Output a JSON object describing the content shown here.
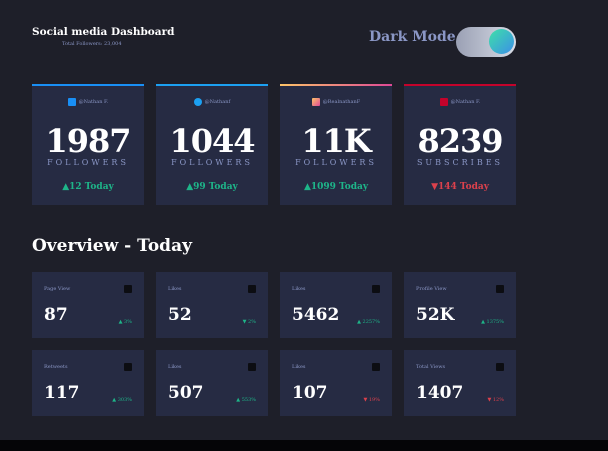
{
  "header": {
    "title": "Social media Dashboard",
    "subtitle": "Total Followers: 23,004",
    "dark_mode_label": "Dark Mode"
  },
  "colors": {
    "facebook": "#198ff5",
    "twitter": "#1ca0f2",
    "instagram_start": "#fdc468",
    "instagram_end": "#df4996",
    "youtube": "#c4032b",
    "up": "#1eb589",
    "down": "#dc414c"
  },
  "cards": [
    {
      "handle": "@Nathan F.",
      "icon": "facebook-icon",
      "value": "1987",
      "label": "FOLLOWERS",
      "change": "▲12 Today",
      "dir": "up"
    },
    {
      "handle": "@Nathanf",
      "icon": "twitter-icon",
      "value": "1044",
      "label": "FOLLOWERS",
      "change": "▲99 Today",
      "dir": "up"
    },
    {
      "handle": "@RealnathanF",
      "icon": "instagram-icon",
      "value": "11K",
      "label": "FOLLOWERS",
      "change": "▲1099 Today",
      "dir": "up"
    },
    {
      "handle": "@Nathan F.",
      "icon": "youtube-icon",
      "value": "8239",
      "label": "SUBSCRIBES",
      "change": "▼144 Today",
      "dir": "down"
    }
  ],
  "overview": {
    "title": "Overview - Today",
    "items": [
      {
        "label": "Page View",
        "icon": "facebook-icon",
        "value": "87",
        "pct": "▲ 3%",
        "dir": "up"
      },
      {
        "label": "Likes",
        "icon": "facebook-icon",
        "value": "52",
        "pct": "▼ 2%",
        "dir": "up"
      },
      {
        "label": "Likes",
        "icon": "instagram-icon",
        "value": "5462",
        "pct": "▲ 2257%",
        "dir": "up"
      },
      {
        "label": "Profile View",
        "icon": "instagram-icon",
        "value": "52K",
        "pct": "▲ 1375%",
        "dir": "up"
      },
      {
        "label": "Retweets",
        "icon": "twitter-icon",
        "value": "117",
        "pct": "▲ 303%",
        "dir": "up"
      },
      {
        "label": "Likes",
        "icon": "twitter-icon",
        "value": "507",
        "pct": "▲ 553%",
        "dir": "up"
      },
      {
        "label": "Likes",
        "icon": "youtube-icon",
        "value": "107",
        "pct": "▼ 19%",
        "dir": "down"
      },
      {
        "label": "Total Views",
        "icon": "youtube-icon",
        "value": "1407",
        "pct": "▼ 12%",
        "dir": "down"
      }
    ]
  }
}
